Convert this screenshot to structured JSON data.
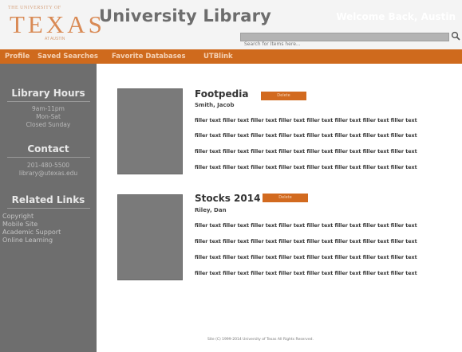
{
  "header": {
    "logo_small": "THE UNIVERSITY OF",
    "logo_text": "TEXAS",
    "logo_sub": "AT AUSTIN",
    "title": "University Library",
    "welcome": "Welcome Back, Austin",
    "search_placeholder": "Search for Items here..."
  },
  "nav": {
    "items": [
      {
        "label": "Profile"
      },
      {
        "label": "Saved Searches"
      },
      {
        "label": "Favorite Databases"
      },
      {
        "label": "UTBlink"
      }
    ]
  },
  "sidebar": {
    "hours_heading": "Library Hours",
    "hours_lines": [
      "9am-11pm",
      "Mon-Sat",
      "Closed Sunday"
    ],
    "contact_heading": "Contact",
    "contact_lines": [
      "201-480-5500",
      "library@utexas.edu"
    ],
    "links_heading": "Related Links",
    "links": [
      {
        "label": "Copyright"
      },
      {
        "label": "Mobile Site"
      },
      {
        "label": "Academic Support"
      },
      {
        "label": "Online Learning"
      }
    ]
  },
  "saved_items": [
    {
      "title": "Footpedia",
      "author": "Smith, Jacob",
      "delete_label": "Delete",
      "lines": [
        "filler text filler text filler text filler text filler text filler text filler text filler text",
        "filler text filler text filler text filler text filler text filler text filler text filler text",
        "filler text filler text filler text filler text filler text filler text filler text filler text",
        "filler text filler text filler text filler text filler text filler text filler text filler text"
      ]
    },
    {
      "title": "Stocks 2014",
      "author": "Riley, Dan",
      "delete_label": "Delete",
      "lines": [
        "filler text filler text filler text filler text filler text filler text filler text filler text",
        "filler text filler text filler text filler text filler text filler text filler text filler text",
        "filler text filler text filler text filler text filler text filler text filler text filler text",
        "filler text filler text filler text filler text filler text filler text filler text filler text"
      ]
    }
  ],
  "footer": {
    "text": "Site (C) 1999-2014 University of Texas All Rights Reserved."
  },
  "colors": {
    "accent": "#cf6a1d",
    "sidebar": "#6e6e6e",
    "logo": "#d98a55"
  }
}
